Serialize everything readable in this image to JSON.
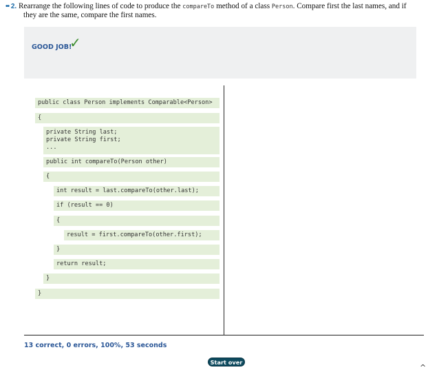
{
  "question": {
    "dots": "••",
    "number": "2.",
    "text_before": "Rearrange the following lines of code to produce the",
    "code1": "compareTo",
    "text_middle": "method of a class",
    "code2": "Person",
    "text_after": ". Compare first the last names, and if",
    "line2": "they are the same, compare the first names."
  },
  "feedback": {
    "message": "GOOD JOB!",
    "check": "✓"
  },
  "code_lines": [
    "public class Person implements Comparable<Person>",
    "{",
    "private String last;\nprivate String first;\n...",
    "public int compareTo(Person other)",
    "{",
    "int result = last.compareTo(other.last);",
    "if (result == 0)",
    "{",
    "result = first.compareTo(other.first);",
    "}",
    "return result;",
    "}",
    "}"
  ],
  "status": "13 correct, 0 errors, 100%, 53 seconds",
  "start_over_label": "Start over",
  "caret": "^"
}
